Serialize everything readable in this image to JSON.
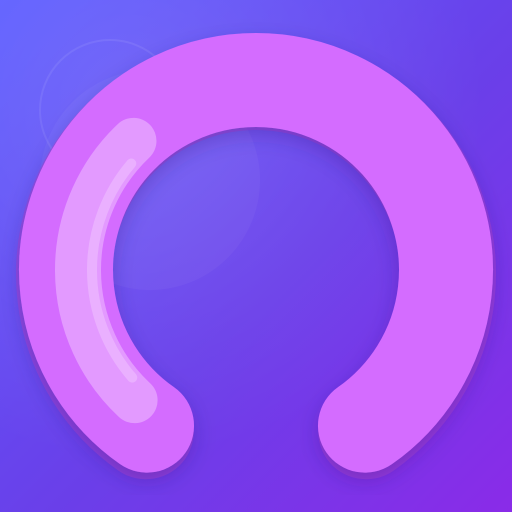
{
  "icon": {
    "name": "progress-ring-app-icon",
    "colors": {
      "background_top_left": "#5b5cff",
      "background_bottom_right": "#8a2be8",
      "background_mid": "#6a3fe9",
      "ring_main": "#d46cff",
      "ring_shadow": "#a546d6",
      "ring_highlight": "#e39aff",
      "ring_highlight_edge": "#f0c2ff",
      "bubble_tint": "#ffffff"
    },
    "highlight_arc_level": 0.35
  }
}
